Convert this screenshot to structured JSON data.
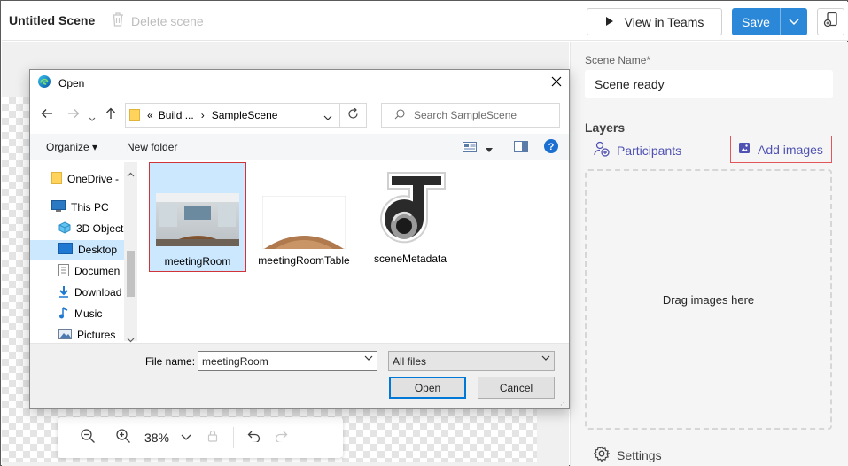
{
  "app": {
    "title": "Untitled Scene",
    "delete_label": "Delete scene",
    "view_in_teams_label": "View in Teams",
    "save_label": "Save"
  },
  "canvas": {
    "zoom": "38%"
  },
  "panel": {
    "scene_name_label": "Scene Name*",
    "scene_name_value": "Scene ready",
    "layers_title": "Layers",
    "participants_label": "Participants",
    "add_images_label": "Add images",
    "drop_hint": "Drag images here",
    "settings_label": "Settings"
  },
  "dialog": {
    "title": "Open",
    "breadcrumb": [
      "«",
      "Build ...",
      "›",
      "SampleScene"
    ],
    "search_placeholder": "Search SampleScene",
    "organize_label": "Organize ▾",
    "new_folder_label": "New folder",
    "sidebar": [
      {
        "label": "OneDrive -",
        "icon": "folder-icon"
      },
      {
        "label": "This PC",
        "icon": "computer-icon"
      },
      {
        "label": "3D Object",
        "icon": "cube-icon"
      },
      {
        "label": "Desktop",
        "icon": "desktop-icon",
        "selected": true
      },
      {
        "label": "Documen",
        "icon": "document-icon"
      },
      {
        "label": "Download",
        "icon": "download-icon"
      },
      {
        "label": "Music",
        "icon": "music-icon"
      },
      {
        "label": "Pictures",
        "icon": "pictures-icon"
      }
    ],
    "files": [
      {
        "label": "meetingRoom",
        "selected": true
      },
      {
        "label": "meetingRoomTable"
      },
      {
        "label": "sceneMetadata"
      }
    ],
    "file_name_label": "File name:",
    "file_name_value": "meetingRoom",
    "file_type_value": "All files",
    "open_label": "Open",
    "cancel_label": "Cancel"
  },
  "colors": {
    "accent": "#2b88d8",
    "link": "#4f52b2",
    "highlight_border": "#d13438",
    "selection": "#cce8ff"
  }
}
